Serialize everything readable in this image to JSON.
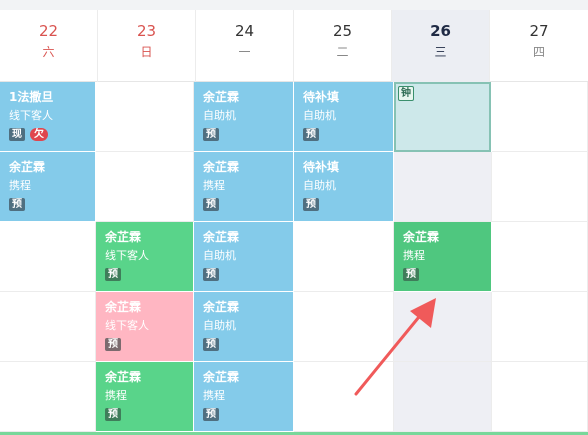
{
  "header": {
    "days": [
      {
        "num": "22",
        "weekday": "六"
      },
      {
        "num": "23",
        "weekday": "日"
      },
      {
        "num": "24",
        "weekday": "一"
      },
      {
        "num": "25",
        "weekday": "二"
      },
      {
        "num": "26",
        "weekday": "三"
      },
      {
        "num": "27",
        "weekday": "四"
      }
    ]
  },
  "cards": {
    "c22_r1": {
      "name": "1法撒旦",
      "sub": "线下客人",
      "tag1": "现",
      "tag2": "欠"
    },
    "c22_r2": {
      "name": "余芷霖",
      "sub": "携程",
      "tag1": "预"
    },
    "c23_r3": {
      "name": "余芷霖",
      "sub": "线下客人",
      "tag1": "预"
    },
    "c23_r4": {
      "name": "余芷霖",
      "sub": "线下客人",
      "tag1": "预"
    },
    "c23_r5": {
      "name": "余芷霖",
      "sub": "携程",
      "tag1": "预"
    },
    "c24_r1": {
      "name": "余芷霖",
      "sub": "自助机",
      "tag1": "预"
    },
    "c24_r2": {
      "name": "余芷霖",
      "sub": "携程",
      "tag1": "预"
    },
    "c24_r3": {
      "name": "余芷霖",
      "sub": "自助机",
      "tag1": "预"
    },
    "c24_r4": {
      "name": "余芷霖",
      "sub": "自助机",
      "tag1": "预"
    },
    "c24_r5": {
      "name": "余芷霖",
      "sub": "携程",
      "tag1": "预"
    },
    "c25_r1": {
      "name": "待补填",
      "sub": "自助机",
      "tag1": "预"
    },
    "c25_r2": {
      "name": "待补填",
      "sub": "自助机",
      "tag1": "预"
    },
    "c26_r3": {
      "name": "余芷霖",
      "sub": "携程",
      "tag1": "预"
    }
  },
  "clock_tag": "钟",
  "colors": {
    "blue": "#84cbea",
    "green": "#59d48a",
    "pink": "#ffb6c2",
    "arrow": "#f05a5a"
  }
}
